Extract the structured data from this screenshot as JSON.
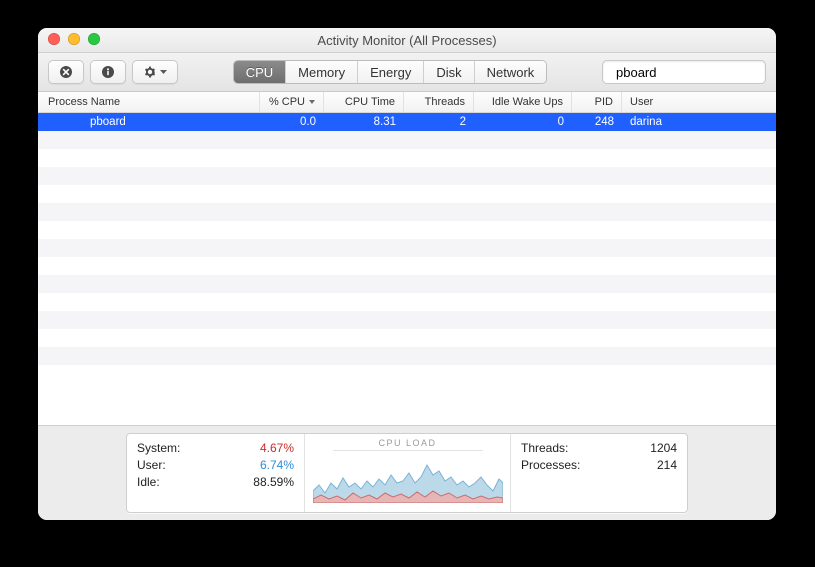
{
  "window": {
    "title": "Activity Monitor (All Processes)"
  },
  "tabs": [
    "CPU",
    "Memory",
    "Energy",
    "Disk",
    "Network"
  ],
  "search": {
    "value": "pboard"
  },
  "columns": [
    "Process Name",
    "% CPU",
    "CPU Time",
    "Threads",
    "Idle Wake Ups",
    "PID",
    "User"
  ],
  "rows": [
    {
      "name": "pboard",
      "cpu": "0.0",
      "cpu_time": "8.31",
      "threads": "2",
      "idle_wake_ups": "0",
      "pid": "248",
      "user": "darina"
    }
  ],
  "summary": {
    "system_label": "System:",
    "system_value": "4.67%",
    "user_label": "User:",
    "user_value": "6.74%",
    "idle_label": "Idle:",
    "idle_value": "88.59%",
    "chart_label": "CPU LOAD",
    "threads_label": "Threads:",
    "threads_value": "1204",
    "processes_label": "Processes:",
    "processes_value": "214"
  }
}
